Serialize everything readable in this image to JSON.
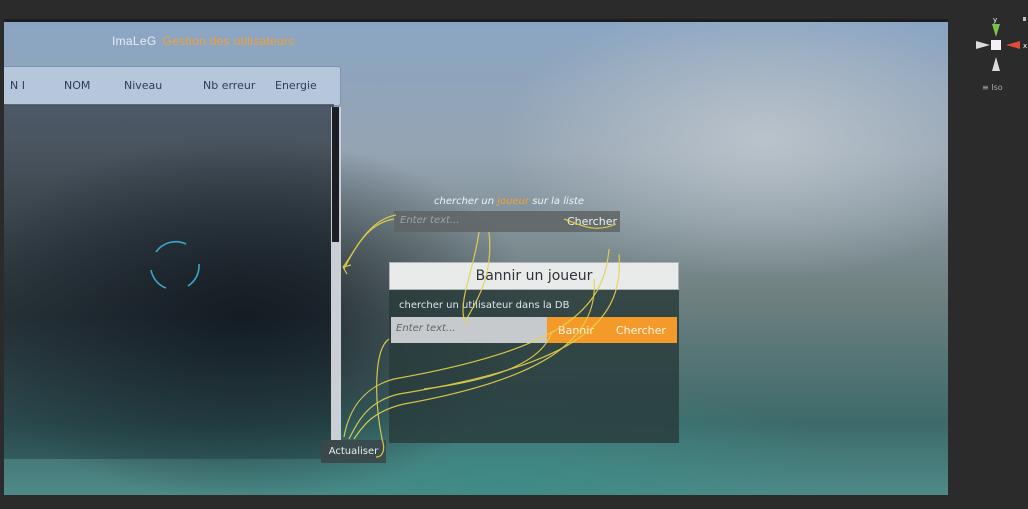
{
  "app": {
    "title": "ImaLeG",
    "subtitle": "Gestion des utilisateurs"
  },
  "table": {
    "columns": [
      "N I",
      "NOM",
      "Niveau",
      "Nb erreur",
      "Energie"
    ]
  },
  "search_list": {
    "label_prefix": "chercher un",
    "label_accent": "joueur",
    "label_suffix": "sur la liste",
    "placeholder": "Enter text...",
    "button": "Chercher"
  },
  "ban_panel": {
    "title": "Bannir un joueur",
    "subtitle": "chercher un utilisateur dans la DB",
    "placeholder": "Enter text...",
    "ban_button": "Bannir",
    "search_button": "Chercher"
  },
  "refresh_button": "Actualiser",
  "gizmo": {
    "axis_y": "y",
    "axis_x": "x",
    "projection": "Iso"
  },
  "colors": {
    "accent": "#f39a2b",
    "header": "#b6c7dc",
    "wire": "#e8d34a"
  }
}
